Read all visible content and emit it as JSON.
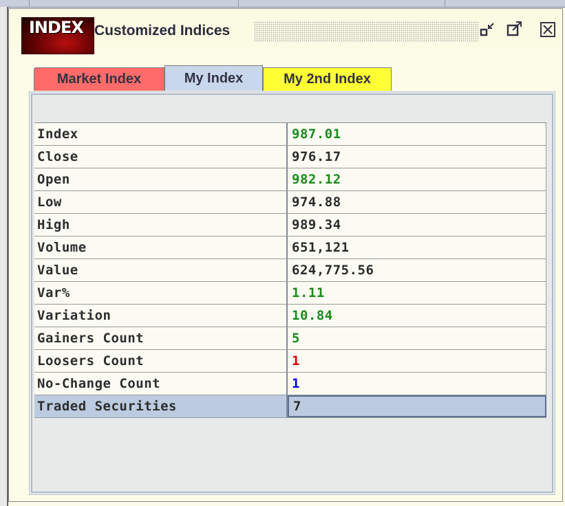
{
  "window": {
    "logo_text": "INDEX",
    "title": "Customized Indices",
    "buttons": [
      "restore-icon",
      "maximize-icon",
      "close-icon"
    ]
  },
  "tabs": [
    {
      "label": "Market Index",
      "color": "#ff6b6b",
      "selected": false
    },
    {
      "label": "My Index",
      "color": "#c8d7ec",
      "selected": true
    },
    {
      "label": "My 2nd Index",
      "color": "#ffff33",
      "selected": false
    }
  ],
  "table": {
    "rows": [
      {
        "label": "Index",
        "value": "987.01",
        "color": "#1c8a1c"
      },
      {
        "label": "Close",
        "value": "976.17",
        "color": "#2b2b2b"
      },
      {
        "label": "Open",
        "value": "982.12",
        "color": "#1c8a1c"
      },
      {
        "label": "Low",
        "value": "974.88",
        "color": "#2b2b2b"
      },
      {
        "label": "High",
        "value": "989.34",
        "color": "#2b2b2b"
      },
      {
        "label": "Volume",
        "value": "651,121",
        "color": "#2b2b2b"
      },
      {
        "label": "Value",
        "value": "624,775.56",
        "color": "#2b2b2b"
      },
      {
        "label": "Var%",
        "value": "1.11",
        "color": "#1c8a1c"
      },
      {
        "label": "Variation",
        "value": "10.84",
        "color": "#1c8a1c"
      },
      {
        "label": "Gainers Count",
        "value": "5",
        "color": "#1c8a1c"
      },
      {
        "label": "Loosers Count",
        "value": "1",
        "color": "#e00000"
      },
      {
        "label": "No-Change Count",
        "value": "1",
        "color": "#0000e0"
      },
      {
        "label": "Traded Securities",
        "value": "7",
        "color": "#2b2b2b",
        "selected": true
      }
    ]
  }
}
